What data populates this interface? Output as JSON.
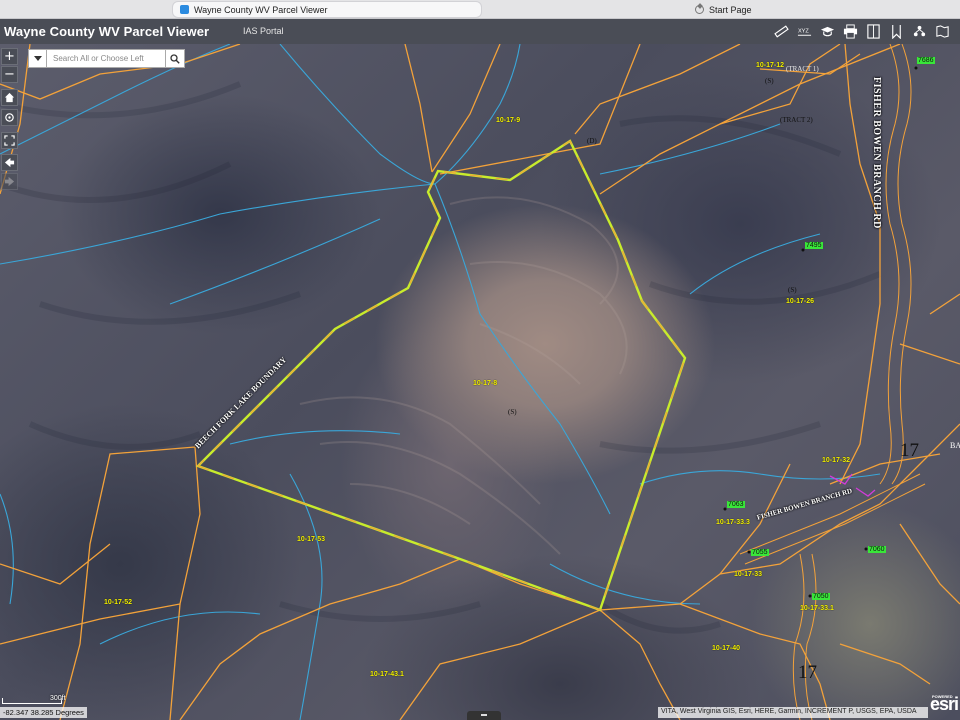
{
  "browser": {
    "tabs": [
      {
        "label": "Wayne County WV Parcel Viewer",
        "active": true
      },
      {
        "label": "Start Page",
        "active": false
      }
    ]
  },
  "header": {
    "title": "Wayne County WV Parcel Viewer",
    "portal_link": "IAS Portal",
    "tools": [
      "measure-icon",
      "xyz-coordinates-icon",
      "education-icon",
      "print-icon",
      "layer-list-icon",
      "bookmark-icon",
      "legend-icon",
      "basemap-icon"
    ],
    "xyz_label": "XYZ"
  },
  "search": {
    "placeholder": "Search All or Choose Left"
  },
  "nav": {
    "zoom_in": "+",
    "zoom_out": "−",
    "home": "⌂",
    "locate": "◎",
    "fullscreen": "⛶",
    "back": "◀",
    "forward": "▶"
  },
  "map": {
    "parcel_labels": [
      "10-17-9",
      "10-17-8",
      "10-17-12",
      "10-17-26",
      "10-17-32",
      "10-17-33.3",
      "10-17-33",
      "10-17-33.1",
      "10-17-53",
      "10-17-52",
      "10-17-40",
      "10-17-43.1"
    ],
    "annotations": [
      "(D)",
      "(S)",
      "(S)",
      "(S)",
      "(TRACT 1)",
      "(TRACT 2)"
    ],
    "addresses": [
      "7686",
      "7495",
      "7063",
      "7055",
      "7060",
      "7050"
    ],
    "roads": {
      "fisher_bowen_vertical": "FISHER BOWEN BRANCH RD",
      "fisher_bowen_horizontal": "FISHER BOWEN BRANCH RD",
      "beech_fork": "BEECH FORK LAKE BOUNDARY"
    },
    "section_numbers": [
      "17",
      "17"
    ],
    "edge_partial": "BA"
  },
  "footer": {
    "scale": "300ft",
    "coordinates": "-82.347 38.285 Degrees",
    "attribution": "VITA, West Virginia GIS, Esri, HERE, Garmin, INCREMENT P, USGS, EPA, USDA",
    "powered_by": "POWERED BY",
    "esri_logo": "esri"
  },
  "colors": {
    "parcel_line": "#f3a23a",
    "stream_line": "#3aa6d8",
    "selected_parcel": "#c8ec2c",
    "label_yellow": "#f4f200",
    "address_green": "#39e639",
    "header_bg": "#4a4d56"
  }
}
